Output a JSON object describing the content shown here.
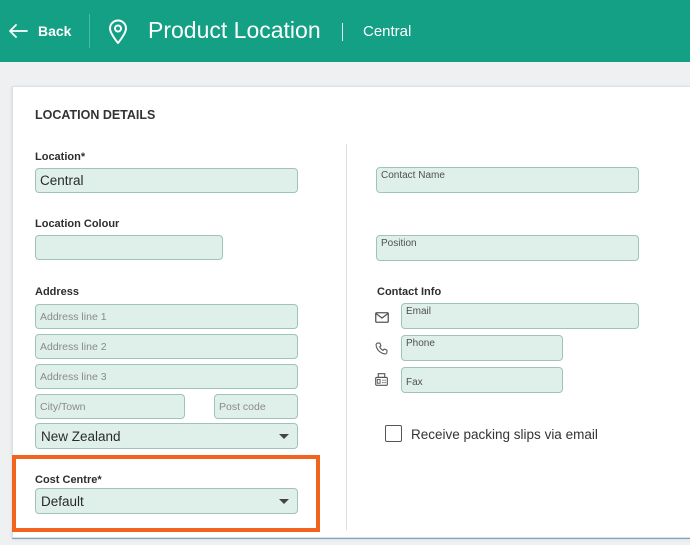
{
  "header": {
    "back_label": "Back",
    "title": "Product Location",
    "subtitle": "Central",
    "bg_color": "#13a085",
    "back_icon": "arrow-left-icon",
    "location_icon": "map-pin-icon"
  },
  "form": {
    "section_title": "LOCATION DETAILS",
    "location": {
      "label": "Location*",
      "value": "Central"
    },
    "location_colour": {
      "label": "Location Colour",
      "value": ""
    },
    "address": {
      "label": "Address",
      "line1_placeholder": "Address line 1",
      "line2_placeholder": "Address line 2",
      "line3_placeholder": "Address line 3",
      "city_placeholder": "City/Town",
      "postcode_placeholder": "Post code",
      "country": "New Zealand"
    },
    "cost_centre": {
      "label": "Cost Centre*",
      "value": "Default"
    },
    "contact_name": {
      "placeholder": "Contact Name"
    },
    "position": {
      "placeholder": "Position"
    },
    "contact_info": {
      "label": "Contact Info",
      "email_placeholder": "Email",
      "phone_placeholder": "Phone",
      "fax_placeholder": "Fax",
      "email_icon": "envelope-icon",
      "phone_icon": "phone-icon",
      "fax_icon": "fax-icon"
    },
    "packing_slips": {
      "label": "Receive packing slips via email",
      "checked": false
    }
  },
  "colors": {
    "field_bg": "#dff0eb",
    "field_border": "#9fc3b9",
    "highlight": "#f2641e"
  }
}
